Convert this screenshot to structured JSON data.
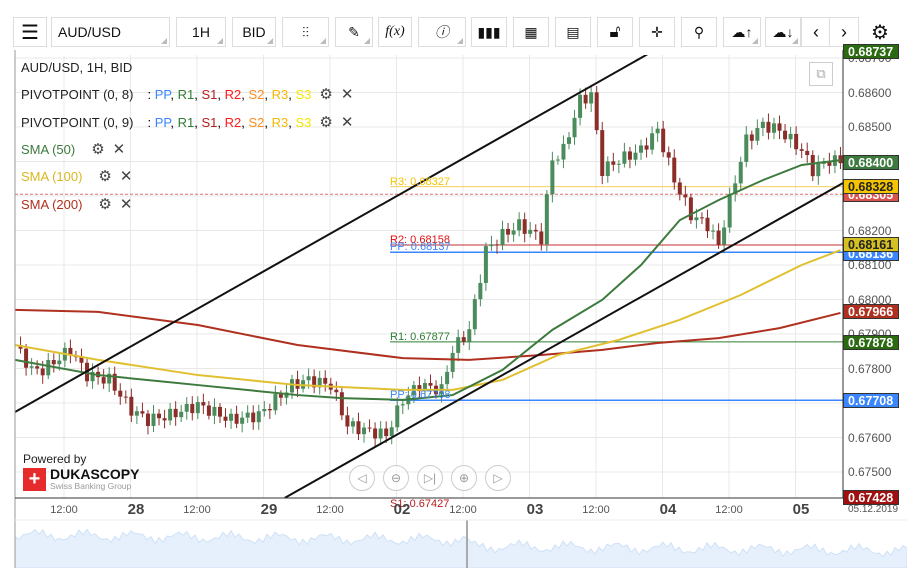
{
  "toolbar": {
    "menu_icon": "hamburger-icon",
    "instrument": "AUD/USD",
    "period": "1H",
    "side": "BID",
    "buttons": [
      "candles-icon",
      "pencil-icon",
      "function-icon",
      "info-icon",
      "bar-chart-icon",
      "calendar-icon",
      "news-icon",
      "lock-icon",
      "crosshair-icon",
      "zoom-chart-icon",
      "upload-cloud-icon",
      "download-cloud-icon",
      "chevron-left-icon",
      "chevron-right-icon",
      "gear-icon"
    ],
    "function_label": "f(x)"
  },
  "legend": {
    "title": "AUD/USD, 1H, BID",
    "pivot1": "PIVOTPOINT (0, 8)",
    "pivot2": "PIVOTPOINT (0, 9)",
    "pivot_items": [
      {
        "t": "PP",
        "c": "#3a86ff"
      },
      {
        "t": "R1",
        "c": "#2e7d32"
      },
      {
        "t": "S1",
        "c": "#b71c1c"
      },
      {
        "t": "R2",
        "c": "#ff1a1a"
      },
      {
        "t": "S2",
        "c": "#ff8c1a"
      },
      {
        "t": "R3",
        "c": "#f5b800"
      },
      {
        "t": "S3",
        "c": "#f5e400"
      }
    ],
    "sma50": "SMA (50)",
    "sma100": "SMA (100)",
    "sma200": "SMA (200)"
  },
  "colors": {
    "up": "#4a8c5c",
    "down": "#8b2e2a",
    "sma50": "#3d7a3d",
    "sma100": "#e0c030",
    "sma200": "#b03020"
  },
  "price_axis": [
    "0.68700",
    "0.68600",
    "0.68500",
    "0.68400",
    "0.68300",
    "0.68200",
    "0.68100",
    "0.68000",
    "0.67900",
    "0.67800",
    "0.67700",
    "0.67600",
    "0.67500"
  ],
  "price_tags": [
    {
      "v": "0.68400",
      "p": 0.684,
      "bg": "#3d7a3d"
    },
    {
      "v": "0.68305",
      "p": 0.68305,
      "bg": "#d9534f"
    },
    {
      "v": "0.68328",
      "p": 0.68328,
      "bg": "#f5c400",
      "fg": "#222"
    },
    {
      "v": "0.68136",
      "p": 0.68136,
      "bg": "#3a86ff"
    },
    {
      "v": "0.68161",
      "p": 0.68161,
      "bg": "#d4c020",
      "fg": "#222"
    },
    {
      "v": "0.67966",
      "p": 0.67966,
      "bg": "#b03020"
    },
    {
      "v": "0.67878",
      "p": 0.67878,
      "bg": "#2a6a10"
    },
    {
      "v": "0.67708",
      "p": 0.67708,
      "bg": "#3a86ff"
    },
    {
      "v": "0.67428",
      "p": 0.67428,
      "bg": "#a01010"
    },
    {
      "v": "0.68737",
      "p": 0.68737,
      "bg": "#2a6a10"
    }
  ],
  "pivot_labels": [
    {
      "t": "R3: 0.68327",
      "p": 0.68327,
      "c": "#f5c400"
    },
    {
      "t": "R2: 0.68158",
      "p": 0.68158,
      "c": "#e01010"
    },
    {
      "t": "PP: 0.68137",
      "p": 0.68137,
      "c": "#3a86ff"
    },
    {
      "t": "R1: 0.67877",
      "p": 0.67877,
      "c": "#2e7d32"
    },
    {
      "t": "PP: 0.67708",
      "p": 0.67708,
      "c": "#3a86ff"
    },
    {
      "t": "S1: 0.67427",
      "p": 0.67427,
      "c": "#b71c1c"
    }
  ],
  "time_axis": {
    "hours": [
      "12:00",
      "12:00",
      "12:00",
      "12:00",
      "12:00",
      "12:00"
    ],
    "days": [
      "28",
      "29",
      "02",
      "03",
      "04",
      "05"
    ],
    "date": "05.12.2019"
  },
  "branding": {
    "powered": "Powered by",
    "name": "DUKASCOPY",
    "sub": "Swiss Banking Group"
  },
  "chart_data": {
    "type": "candlestick",
    "ylim": [
      0.674,
      0.6875
    ],
    "closes": [
      [
        0,
        0.67868
      ],
      [
        3,
        0.67796
      ],
      [
        5,
        0.67796
      ],
      [
        10,
        0.67854
      ],
      [
        13,
        0.67781
      ],
      [
        17,
        0.67767
      ],
      [
        21,
        0.6768
      ],
      [
        24,
        0.67651
      ],
      [
        28,
        0.67665
      ],
      [
        33,
        0.67694
      ],
      [
        39,
        0.67651
      ],
      [
        44,
        0.67665
      ],
      [
        50,
        0.67752
      ],
      [
        53,
        0.67767
      ],
      [
        57,
        0.67752
      ],
      [
        60,
        0.67636
      ],
      [
        63,
        0.67622
      ],
      [
        67,
        0.67607
      ],
      [
        70,
        0.67709
      ],
      [
        73,
        0.67752
      ],
      [
        77,
        0.67738
      ],
      [
        79,
        0.67854
      ],
      [
        82,
        0.67912
      ],
      [
        85,
        0.68143
      ],
      [
        88,
        0.68187
      ],
      [
        91,
        0.68216
      ],
      [
        95,
        0.68178
      ],
      [
        97,
        0.68404
      ],
      [
        99,
        0.68433
      ],
      [
        102,
        0.68578
      ],
      [
        104,
        0.68593
      ],
      [
        106,
        0.68375
      ],
      [
        109,
        0.68404
      ],
      [
        113,
        0.68433
      ],
      [
        116,
        0.68491
      ],
      [
        119,
        0.68346
      ],
      [
        122,
        0.68245
      ],
      [
        125,
        0.68216
      ],
      [
        127,
        0.68158
      ],
      [
        129,
        0.68288
      ],
      [
        132,
        0.68462
      ],
      [
        135,
        0.68506
      ],
      [
        138,
        0.68491
      ],
      [
        142,
        0.68433
      ],
      [
        144,
        0.68375
      ],
      [
        147,
        0.68404
      ],
      [
        149,
        0.684
      ]
    ],
    "sma50": [
      [
        0,
        0.67825
      ],
      [
        15,
        0.67781
      ],
      [
        33,
        0.67752
      ],
      [
        51,
        0.67723
      ],
      [
        59,
        0.67714
      ],
      [
        70,
        0.67709
      ],
      [
        79,
        0.67723
      ],
      [
        88,
        0.67796
      ],
      [
        97,
        0.67912
      ],
      [
        106,
        0.67999
      ],
      [
        113,
        0.681
      ],
      [
        120,
        0.6823
      ],
      [
        127,
        0.68288
      ],
      [
        135,
        0.68346
      ],
      [
        142,
        0.6839
      ],
      [
        149,
        0.68404
      ]
    ],
    "sma100": [
      [
        0,
        0.67868
      ],
      [
        15,
        0.67825
      ],
      [
        33,
        0.67781
      ],
      [
        51,
        0.67752
      ],
      [
        70,
        0.67738
      ],
      [
        79,
        0.67738
      ],
      [
        88,
        0.67767
      ],
      [
        98,
        0.67839
      ],
      [
        109,
        0.67883
      ],
      [
        120,
        0.67941
      ],
      [
        131,
        0.68013
      ],
      [
        142,
        0.681
      ],
      [
        149,
        0.68143
      ]
    ],
    "sma200": [
      [
        0,
        0.6797
      ],
      [
        15,
        0.67964
      ],
      [
        33,
        0.67926
      ],
      [
        51,
        0.67868
      ],
      [
        70,
        0.6783
      ],
      [
        82,
        0.67825
      ],
      [
        95,
        0.67839
      ],
      [
        106,
        0.67854
      ],
      [
        116,
        0.67874
      ],
      [
        127,
        0.67888
      ],
      [
        138,
        0.67917
      ],
      [
        149,
        0.67961
      ]
    ],
    "sma200_last": 0.68305,
    "trendlines": [
      [
        [
          0,
          0.67674
        ],
        [
          115.5,
          0.68723
        ]
      ],
      [
        [
          48.7,
          0.67425
        ],
        [
          149.5,
          0.68338
        ]
      ]
    ]
  }
}
